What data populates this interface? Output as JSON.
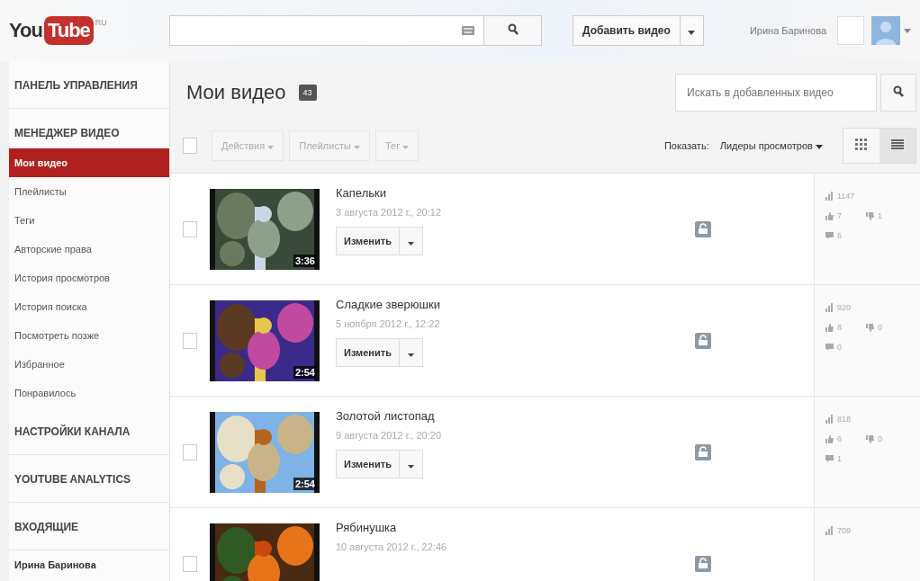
{
  "header": {
    "logo": {
      "left": "You",
      "right": "Tube",
      "region": "RU"
    },
    "upload_button": "Добавить видео",
    "user_name": "Ирина Баринова"
  },
  "sidebar": {
    "sections": [
      {
        "title": "ПАНЕЛЬ УПРАВЛЕНИЯ"
      },
      {
        "title": "МЕНЕДЖЕР ВИДЕО",
        "items": [
          {
            "label": "Мои видео",
            "selected": true
          },
          {
            "label": "Плейлисты",
            "selected": false
          },
          {
            "label": "Теги",
            "selected": false
          },
          {
            "label": "Авторские права",
            "selected": false
          },
          {
            "label": "История просмотров",
            "selected": false
          },
          {
            "label": "История поиска",
            "selected": false
          },
          {
            "label": "Посмотреть позже",
            "selected": false
          },
          {
            "label": "Избранное",
            "selected": false
          },
          {
            "label": "Понравилось",
            "selected": false
          }
        ]
      },
      {
        "title": "НАСТРОЙКИ КАНАЛА"
      },
      {
        "title": "YOUTUBE ANALYTICS"
      },
      {
        "title": "ВХОДЯЩИЕ"
      }
    ],
    "footer_user": "Ирина Баринова"
  },
  "main": {
    "title": "Мои видео",
    "count": "43",
    "search": {
      "placeholder": "Искать в добавленных видео"
    },
    "select_all_checked": false,
    "actions": [
      "Действия",
      "Плейлисты",
      "Тег"
    ],
    "sort_label": "Показать:",
    "sort_value": "Лидеры просмотров",
    "view_modes": [
      {
        "kind": "grid",
        "selected": false
      },
      {
        "kind": "list",
        "selected": true
      }
    ],
    "videos": [
      {
        "checked": false,
        "title": "Капельки",
        "date": "3 августа 2012 г., 20:12",
        "duration": "3:36",
        "edit": "Изменить",
        "views": "1147",
        "likes": "7",
        "dislikes": "1",
        "comments": "6"
      },
      {
        "checked": false,
        "title": "Сладкие зверюшки",
        "date": "5 ноября 2012 г., 12:22",
        "duration": "2:54",
        "edit": "Изменить",
        "views": "920",
        "likes": "8",
        "dislikes": "0",
        "comments": "0"
      },
      {
        "checked": false,
        "title": "Золотой листопад",
        "date": "9 августа 2012 г., 20:20",
        "duration": "2:54",
        "edit": "Изменить",
        "views": "818",
        "likes": "6",
        "dislikes": "0",
        "comments": "1"
      },
      {
        "checked": false,
        "title": "Рябинушка",
        "date": "10 августа 2012 г., 22:46",
        "views": "709"
      }
    ]
  }
}
